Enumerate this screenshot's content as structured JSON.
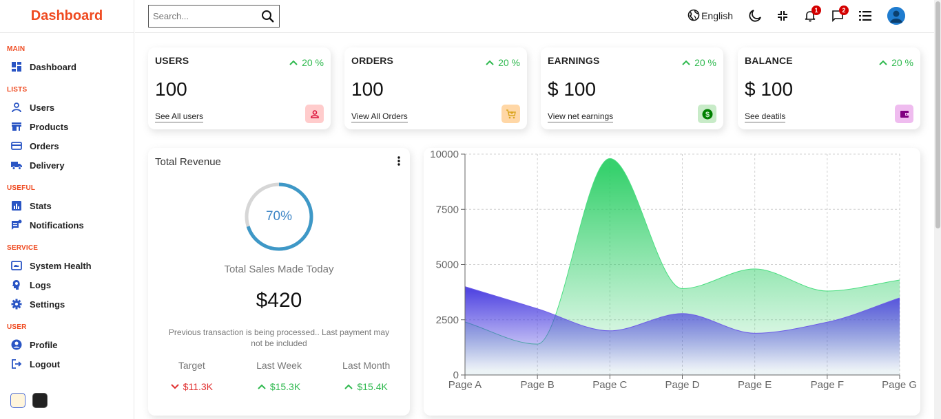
{
  "app": {
    "title": "Dashboard"
  },
  "sidebar": {
    "sections": [
      {
        "title": "MAIN",
        "items": [
          {
            "label": "Dashboard",
            "icon": "dashboard-icon"
          }
        ]
      },
      {
        "title": "LISTS",
        "items": [
          {
            "label": "Users",
            "icon": "user-icon"
          },
          {
            "label": "Products",
            "icon": "store-icon"
          },
          {
            "label": "Orders",
            "icon": "credit-card-icon"
          },
          {
            "label": "Delivery",
            "icon": "truck-icon"
          }
        ]
      },
      {
        "title": "USEFUL",
        "items": [
          {
            "label": "Stats",
            "icon": "bar-chart-icon"
          },
          {
            "label": "Notifications",
            "icon": "notifications-icon"
          }
        ]
      },
      {
        "title": "SERVICE",
        "items": [
          {
            "label": "System Health",
            "icon": "system-health-icon"
          },
          {
            "label": "Logs",
            "icon": "psychology-icon"
          },
          {
            "label": "Settings",
            "icon": "settings-icon"
          }
        ]
      },
      {
        "title": "USER",
        "items": [
          {
            "label": "Profile",
            "icon": "account-circle-icon"
          },
          {
            "label": "Logout",
            "icon": "logout-icon"
          }
        ]
      }
    ],
    "theme_options": [
      "light",
      "dark"
    ]
  },
  "topbar": {
    "search_placeholder": "Search...",
    "language": "English",
    "notifications_count": "1",
    "messages_count": "2"
  },
  "widgets": [
    {
      "title": "USERS",
      "percent": "20 %",
      "value": "100",
      "link": "See All users",
      "icon": "person-icon",
      "icon_color": "#dc143c",
      "icon_bg": "#ffcccc"
    },
    {
      "title": "ORDERS",
      "percent": "20 %",
      "value": "100",
      "link": "View All Orders",
      "icon": "shopping-cart-icon",
      "icon_color": "#daa520",
      "icon_bg": "#ffd7a6"
    },
    {
      "title": "EARNINGS",
      "percent": "20 %",
      "value": "$ 100",
      "link": "View net earnings",
      "icon": "dollar-icon",
      "icon_color": "#008000",
      "icon_bg": "#c8ebc8"
    },
    {
      "title": "BALANCE",
      "percent": "20 %",
      "value": "$ 100",
      "link": "See deatils",
      "icon": "wallet-icon",
      "icon_color": "#800080",
      "icon_bg": "#efbcef"
    }
  ],
  "revenue": {
    "title": "Total Revenue",
    "progress_percent": 70,
    "progress_label": "70%",
    "subtitle": "Total Sales Made Today",
    "amount": "$420",
    "note": "Previous transaction is being processed.. Last payment may not be included",
    "stats": [
      {
        "label": "Target",
        "value": "$11.3K",
        "trend": "down"
      },
      {
        "label": "Last Week",
        "value": "$15.3K",
        "trend": "up"
      },
      {
        "label": "Last Month",
        "value": "$15.4K",
        "trend": "up"
      }
    ]
  },
  "chart_data": {
    "type": "area",
    "categories": [
      "Page A",
      "Page B",
      "Page C",
      "Page D",
      "Page E",
      "Page F",
      "Page G"
    ],
    "series": [
      {
        "values": [
          2400,
          1398,
          9800,
          3908,
          4800,
          3800,
          4300
        ],
        "color": "#4ade80"
      },
      {
        "values": [
          4000,
          3000,
          2000,
          2780,
          1890,
          2390,
          3490
        ],
        "color": "#6d5ce7"
      }
    ],
    "yticks": [
      0,
      2500,
      5000,
      7500,
      10000
    ],
    "ylim": [
      0,
      10000
    ],
    "grid": true
  }
}
